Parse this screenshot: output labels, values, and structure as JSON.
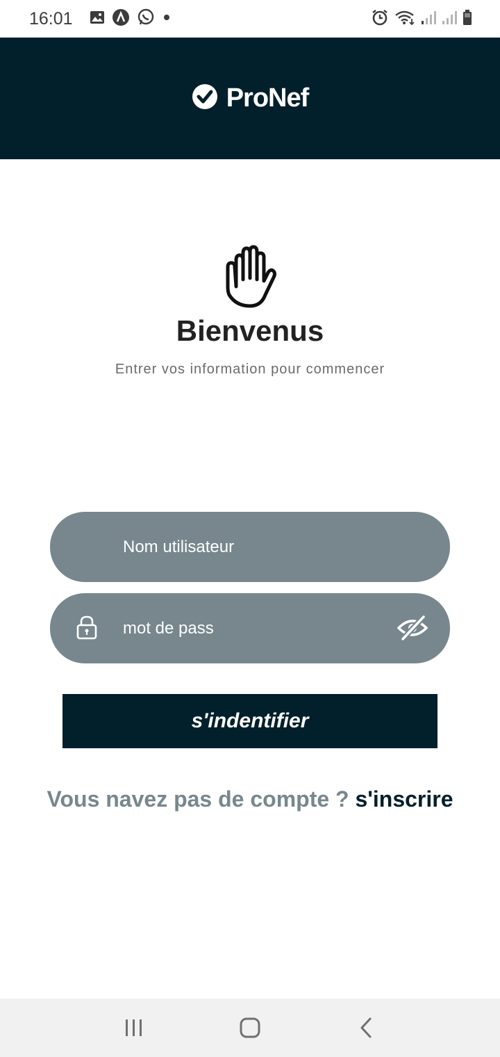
{
  "status_bar": {
    "time": "16:01",
    "left_icons": [
      "gallery-icon",
      "app-a-icon",
      "whatsapp-icon",
      "dot-icon"
    ],
    "right_icons": [
      "alarm-icon",
      "wifi-icon",
      "signal-icon",
      "signal-icon",
      "battery-icon"
    ]
  },
  "header": {
    "brand_name": "ProNef",
    "logo_icon": "check-circle-icon",
    "background": "#021f2c"
  },
  "welcome": {
    "icon": "hand-icon",
    "title": "Bienvenus",
    "subtitle": "Entrer vos information pour commencer"
  },
  "form": {
    "username_placeholder": "Nom utilisateur",
    "password_placeholder": "mot de pass",
    "password_icon": "lock-icon",
    "toggle_icon": "eye-off-icon",
    "field_color": "#77878d"
  },
  "login_button": {
    "label": "s'indentifier"
  },
  "register": {
    "question": "Vous navez pas de compte ?",
    "link": "s'inscrire"
  },
  "nav_bar": {
    "items": [
      "recent-apps-icon",
      "home-icon",
      "back-icon"
    ]
  }
}
